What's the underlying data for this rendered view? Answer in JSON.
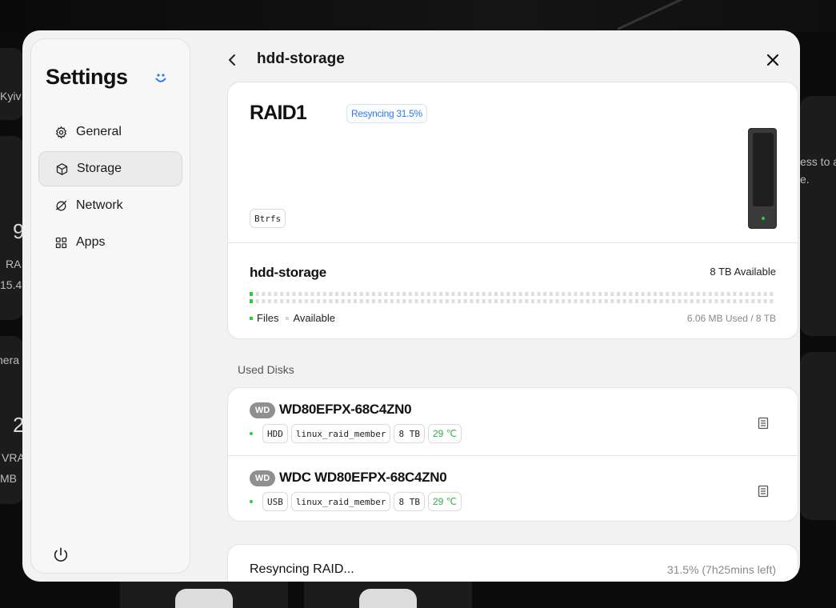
{
  "background": {
    "left_tile_texts": [
      "Kyiv",
      "9",
      "RA",
      "15.4",
      "nera",
      "2",
      "VRA",
      "MB"
    ],
    "right_tile_texts": [
      "ess to a",
      "e."
    ]
  },
  "sidebar": {
    "title": "Settings",
    "items": [
      {
        "label": "General",
        "icon": "gear-icon"
      },
      {
        "label": "Storage",
        "icon": "cube-icon",
        "active": true
      },
      {
        "label": "Network",
        "icon": "globe-icon"
      },
      {
        "label": "Apps",
        "icon": "grid-icon"
      }
    ]
  },
  "header": {
    "title": "hdd-storage"
  },
  "raid": {
    "name": "RAID1",
    "status_badge": "Resyncing 31.5%",
    "filesystem": "Btrfs",
    "pool_name": "hdd-storage",
    "available": "8 TB Available",
    "used_fraction": 1e-06,
    "legend_files": "Files",
    "legend_available": "Available",
    "used_text": "6.06 MB Used / 8 TB"
  },
  "used_disks": {
    "label": "Used Disks",
    "disks": [
      {
        "brand": "WD",
        "name": "WD80EFPX-68C4ZN0",
        "tags": [
          "HDD",
          "linux_raid_member",
          "8 TB"
        ],
        "temp": "29 ℃"
      },
      {
        "brand": "WD",
        "name": "WDC WD80EFPX-68C4ZN0",
        "tags": [
          "USB",
          "linux_raid_member",
          "8 TB"
        ],
        "temp": "29 ℃"
      }
    ]
  },
  "resync": {
    "label": "Resyncing RAID...",
    "progress": "31.5% (7h25mins left)"
  },
  "colors": {
    "accent_blue": "#2f7ae5",
    "ok_green": "#2ecc40",
    "temp_green": "#2aae4a"
  }
}
